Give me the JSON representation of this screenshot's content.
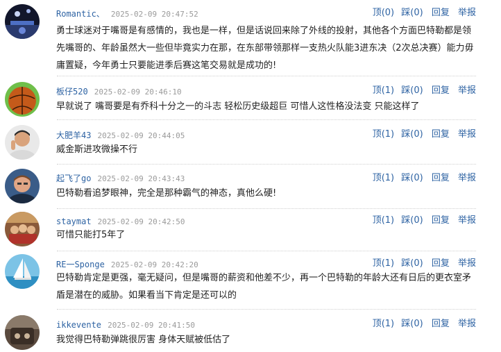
{
  "actions": {
    "reply": "回复",
    "report": "举报"
  },
  "comments": [
    {
      "user": "Romantic、",
      "time": "2025-02-09 20:47:52",
      "up": "顶(0)",
      "down": "踩(0)",
      "text": "勇士球迷对于嘴哥是有感情的，我也是一样，但是话说回来除了外线的投射，其他各个方面巴特勒都是领先嘴哥的、年龄虽然大一些但毕竟实力在那，在东部带领那样一支热火队能3进东决（2次总决赛）能力毋庸置疑，今年勇士只要能进季后赛这笔交易就是成功的!"
    },
    {
      "user": "板仔520",
      "time": "2025-02-09 20:46:10",
      "up": "顶(1)",
      "down": "踩(0)",
      "text": "早就说了 嘴哥要是有乔科十分之一的斗志 轻松历史级超巨 可惜人这性格没法变 只能这样了"
    },
    {
      "user": "大肥羊43",
      "time": "2025-02-09 20:44:05",
      "up": "顶(1)",
      "down": "踩(0)",
      "text": "威金斯进攻微操不行"
    },
    {
      "user": "起飞了go",
      "time": "2025-02-09 20:43:43",
      "up": "顶(1)",
      "down": "踩(0)",
      "text": "巴特勒看追梦眼神，完全是那种霸气的神态，真他么硬!"
    },
    {
      "user": "staymat",
      "time": "2025-02-09 20:42:50",
      "up": "顶(1)",
      "down": "踩(0)",
      "text": "可惜只能打5年了"
    },
    {
      "user": "RE一Sponge",
      "time": "2025-02-09 20:42:20",
      "up": "顶(1)",
      "down": "踩(0)",
      "text": "巴特勒肯定是更强，毫无疑问，但是嘴哥的薪资和他差不少，再一个巴特勒的年龄大还有日后的更衣室矛盾是潜在的威胁。如果看当下肯定是还可以的"
    },
    {
      "user": "ikkevente",
      "time": "2025-02-09 20:41:50",
      "up": "顶(1)",
      "down": "踩(0)",
      "text": "我觉得巴特勒弹跳很厉害 身体天赋被低估了"
    }
  ]
}
